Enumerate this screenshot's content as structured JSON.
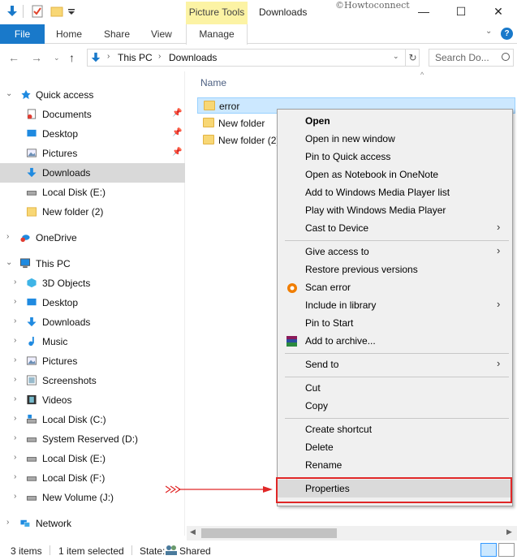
{
  "window": {
    "title": "Downloads",
    "context_tab": "Picture Tools",
    "watermark": "©Howtoconnect",
    "minimize": "—",
    "maximize": "☐",
    "close": "✕"
  },
  "ribbon": {
    "tabs": [
      "File",
      "Home",
      "Share",
      "View",
      "Manage"
    ]
  },
  "address": {
    "path": [
      "This PC",
      "Downloads"
    ],
    "search_placeholder": "Search Do..."
  },
  "nav": {
    "quick_access": "Quick access",
    "quick_items": [
      "Documents",
      "Desktop",
      "Pictures",
      "Downloads",
      "Local Disk (E:)",
      "New folder (2)"
    ],
    "onedrive": "OneDrive",
    "this_pc": "This PC",
    "pc_items": [
      "3D Objects",
      "Desktop",
      "Downloads",
      "Music",
      "Pictures",
      "Screenshots",
      "Videos",
      "Local Disk (C:)",
      "System Reserved (D:)",
      "Local Disk (E:)",
      "Local Disk (F:)",
      "New Volume (J:)"
    ],
    "network": "Network"
  },
  "content": {
    "column_name": "Name",
    "files": [
      "error",
      "New folder",
      "New folder (2)"
    ]
  },
  "context_menu": {
    "group1": [
      "Open",
      "Open in new window",
      "Pin to Quick access",
      "Open as Notebook in OneNote",
      "Add to Windows Media Player list",
      "Play with Windows Media Player",
      "Cast to Device"
    ],
    "group2": [
      "Give access to",
      "Restore previous versions",
      "Scan error",
      "Include in library",
      "Pin to Start",
      "Add to archive..."
    ],
    "group3": [
      "Send to"
    ],
    "group4": [
      "Cut",
      "Copy"
    ],
    "group5": [
      "Create shortcut",
      "Delete",
      "Rename"
    ],
    "group6": [
      "Properties"
    ]
  },
  "status": {
    "items": "3 items",
    "selected": "1 item selected",
    "state_label": "State:",
    "state_value": "Shared"
  },
  "colors": {
    "accent": "#1979ca",
    "context_tab": "#fcf3a4",
    "selection": "#cce8ff",
    "highlight_box": "#e02727"
  }
}
